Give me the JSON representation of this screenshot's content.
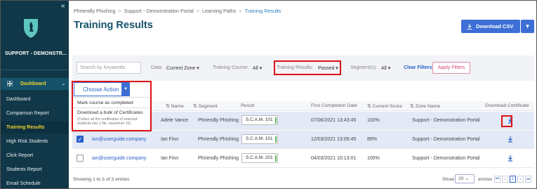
{
  "sidebar": {
    "collapse_glyph": "«",
    "org_name": "SUPPORT - DEMONSTR...",
    "section_label": "Dashboard",
    "items": [
      {
        "label": "Dashboard"
      },
      {
        "label": "Comparison Report"
      },
      {
        "label": "Training Results"
      },
      {
        "label": "High Risk Students"
      },
      {
        "label": "Click Report"
      },
      {
        "label": "Students Report"
      },
      {
        "label": "Email Schedule"
      }
    ]
  },
  "breadcrumb": {
    "items": [
      "Phriendly Phishing",
      "Support - Demonstration Portal",
      "Learning Paths",
      "Training Results"
    ],
    "separator": ">"
  },
  "page_title": "Training Results",
  "download_csv_label": "Download CSV",
  "filters": {
    "search_placeholder": "Search by Keywords",
    "data_label": "Data:",
    "data_value": "Current Zone",
    "course_label": "Training Course:",
    "course_value": "All",
    "results_label": "Training Results:",
    "results_value": "Passed",
    "segments_label": "Segment(s):",
    "segments_value": "All",
    "clear_label": "Clear Filters",
    "apply_label": "Apply Filters"
  },
  "choose_action": {
    "label": "Choose Action",
    "menu": {
      "item1": "Mark course as completed",
      "item2": "Download a bulk of Certificates",
      "item2_note": "(Collect all the certificates of selected students into 1 file, maximum 10)"
    }
  },
  "table": {
    "headers": {
      "name": "Name",
      "segment": "Segment",
      "result": "Result",
      "first_completion": "First Completion Date",
      "current_score": "Current Score",
      "zone": "Zone Name",
      "download": "Download Certificate"
    },
    "rows": [
      {
        "email": "",
        "name": "Adele Vance",
        "segment": "Phriendly Phishing",
        "result": "S.C.A.M. 101",
        "date": "07/06/2021 13:43:45",
        "score": "100%",
        "zone": "Support - Demonstration Portal",
        "checked": false
      },
      {
        "email": "ian@userguide.company",
        "name": "Ian Finn",
        "segment": "Phriendly Phishing",
        "result": "S.C.A.M. 101",
        "date": "12/03/2021 13:05:45",
        "score": "89%",
        "zone": "Support - Demonstration Portal",
        "checked": true
      },
      {
        "email": "ian@userguide.company",
        "name": "Ian Finn",
        "segment": "Phriendly Phishing",
        "result": "S.C.A.M. 201",
        "date": "04/03/2021 10:13:01",
        "score": "100%",
        "zone": "Support - Demonstration Portal",
        "checked": false
      }
    ]
  },
  "footer": {
    "showing": "Showing 1 to 3 of 3 entries",
    "show_label": "Show",
    "page_size": "20",
    "entries_label": "entries",
    "pager": [
      "⏮",
      "‹",
      "1",
      "›",
      "⏭"
    ]
  },
  "colors": {
    "sidebar": "#103848",
    "accent": "#3d6fd6",
    "highlight": "#f2d22e",
    "annotation": "#dd1111"
  }
}
